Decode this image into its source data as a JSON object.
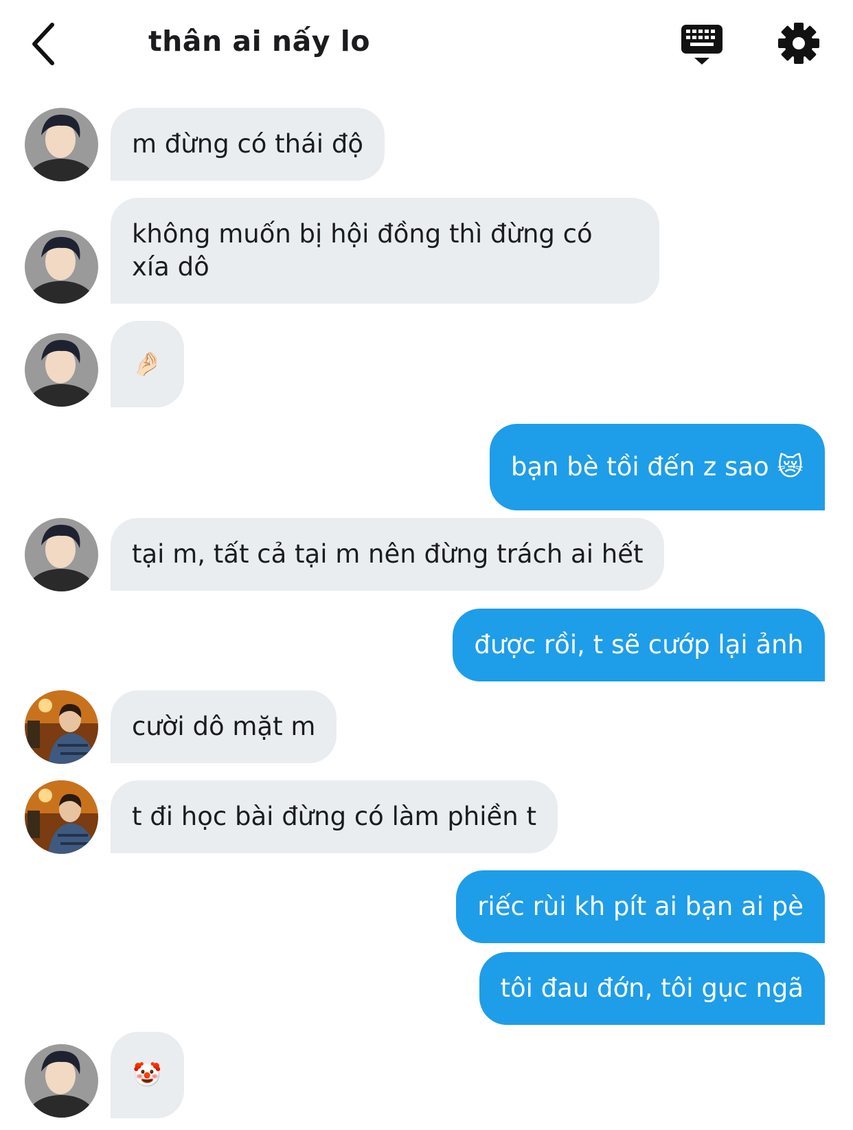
{
  "header": {
    "back_icon": "chevron-left-icon",
    "title": "thân ai nấy lo",
    "keyboard_icon": "keyboard-icon",
    "settings_icon": "gear-icon"
  },
  "messages": [
    {
      "side": "in",
      "avatar": "avatar-a",
      "text": "m đừng có thái độ"
    },
    {
      "side": "in",
      "avatar": "avatar-a",
      "text": "không muốn bị hội đồng thì đừng có xía dô"
    },
    {
      "side": "in",
      "avatar": "avatar-a",
      "text": "🤌🏻"
    },
    {
      "side": "out",
      "text": "bạn bè tồi đến z sao 😿"
    },
    {
      "side": "in",
      "avatar": "avatar-a",
      "text": "tại m, tất cả tại m nên đừng trách ai hết"
    },
    {
      "side": "out",
      "text": "được rồi, t sẽ cướp lại ảnh"
    },
    {
      "side": "in",
      "avatar": "avatar-b",
      "text": "cười dô mặt m"
    },
    {
      "side": "in",
      "avatar": "avatar-b",
      "text": "t đi học bài đừng có làm phiền t"
    },
    {
      "side": "out",
      "text": "riếc rùi kh pít ai bạn ai pè"
    },
    {
      "side": "out",
      "text": "tôi đau đớn, tôi gục ngã"
    },
    {
      "side": "in",
      "avatar": "avatar-a",
      "text": "🤡"
    }
  ],
  "colors": {
    "incoming_bubble": "#e9edf0",
    "outgoing_bubble": "#1e9de9",
    "outgoing_text": "#ffffff",
    "text": "#1c1c1e"
  }
}
